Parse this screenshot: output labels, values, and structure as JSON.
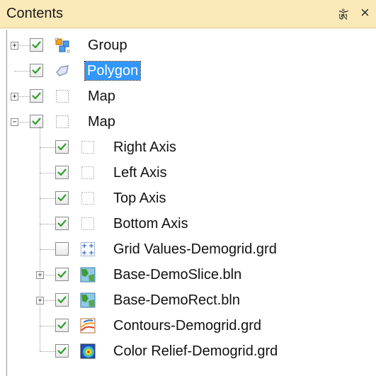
{
  "panel": {
    "title": "Contents",
    "pin_glyph": "ༀ",
    "close_glyph": "×"
  },
  "tree": [
    {
      "label": "Group",
      "checked": true,
      "expander": "plus",
      "icon": "group-icon",
      "level": 0,
      "selected": false
    },
    {
      "label": "Polygon",
      "checked": true,
      "expander": "none",
      "icon": "polygon-icon",
      "level": 0,
      "selected": true
    },
    {
      "label": "Map",
      "checked": true,
      "expander": "plus",
      "icon": "map-icon",
      "level": 0,
      "selected": false
    },
    {
      "label": "Map",
      "checked": true,
      "expander": "minus",
      "icon": "map-icon",
      "level": 0,
      "selected": false
    },
    {
      "label": "Right Axis",
      "checked": true,
      "expander": "none",
      "icon": "axis-icon",
      "level": 1,
      "selected": false
    },
    {
      "label": "Left Axis",
      "checked": true,
      "expander": "none",
      "icon": "axis-icon",
      "level": 1,
      "selected": false
    },
    {
      "label": "Top Axis",
      "checked": true,
      "expander": "none",
      "icon": "axis-icon",
      "level": 1,
      "selected": false
    },
    {
      "label": "Bottom Axis",
      "checked": true,
      "expander": "none",
      "icon": "axis-icon",
      "level": 1,
      "selected": false
    },
    {
      "label": "Grid Values-Demogrid.grd",
      "checked": false,
      "expander": "none",
      "icon": "grid-values-icon",
      "level": 1,
      "selected": false
    },
    {
      "label": "Base-DemoSlice.bln",
      "checked": true,
      "expander": "plus",
      "icon": "base-map-icon",
      "level": 1,
      "selected": false
    },
    {
      "label": "Base-DemoRect.bln",
      "checked": true,
      "expander": "plus",
      "icon": "base-map-icon",
      "level": 1,
      "selected": false
    },
    {
      "label": "Contours-Demogrid.grd",
      "checked": true,
      "expander": "none",
      "icon": "contour-icon",
      "level": 1,
      "selected": false
    },
    {
      "label": "Color Relief-Demogrid.grd",
      "checked": true,
      "expander": "none",
      "icon": "color-relief-icon",
      "level": 1,
      "selected": false
    }
  ]
}
